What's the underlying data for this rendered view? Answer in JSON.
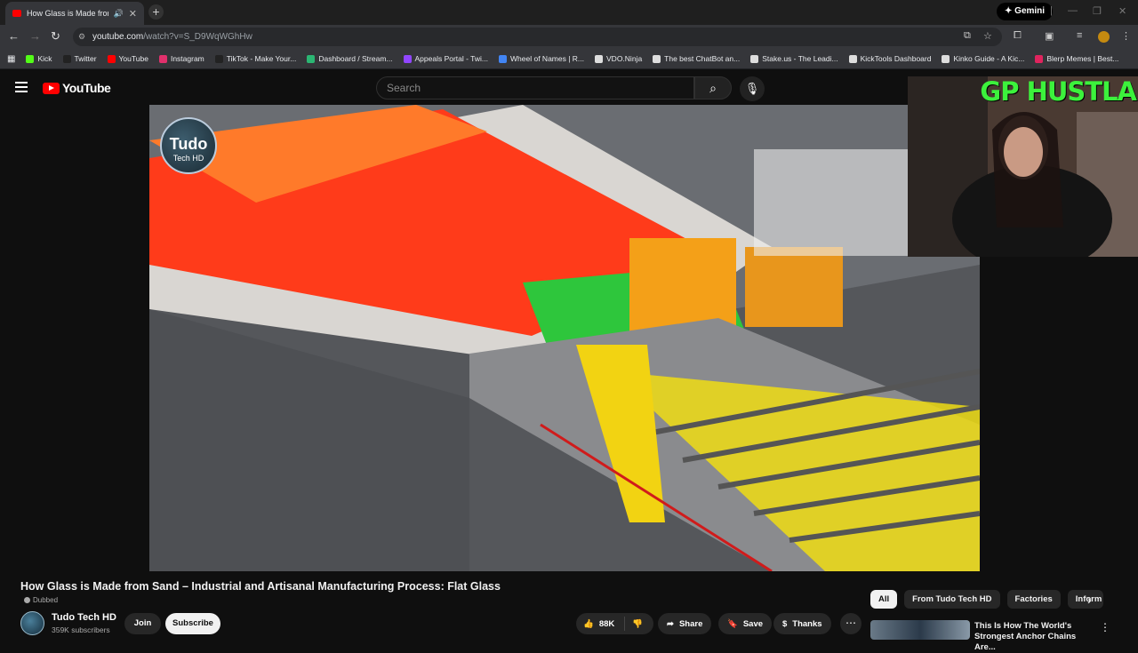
{
  "browser": {
    "tab_title": "How Glass is Made from Sa",
    "new_tab": "+",
    "tab_close": "✕",
    "gemini_label": "Gemini",
    "url_host": "youtube.com",
    "url_path": "/watch?v=S_D9WqWGhHw",
    "bookmarks": [
      {
        "label": "Kick",
        "color": "#53fc18"
      },
      {
        "label": "Twitter",
        "color": "#222222"
      },
      {
        "label": "YouTube",
        "color": "#ff0000"
      },
      {
        "label": "Instagram",
        "color": "#e1306c"
      },
      {
        "label": "TikTok - Make Your...",
        "color": "#222222"
      },
      {
        "label": "Dashboard / Stream...",
        "color": "#2bb673"
      },
      {
        "label": "Appeals Portal - Twi...",
        "color": "#9146ff"
      },
      {
        "label": "Wheel of Names | R...",
        "color": "#4285f4"
      },
      {
        "label": "VDO.Ninja",
        "color": "#dddddd"
      },
      {
        "label": "The best ChatBot an...",
        "color": "#dddddd"
      },
      {
        "label": "Stake.us - The Leadi...",
        "color": "#dddddd"
      },
      {
        "label": "KickTools Dashboard",
        "color": "#dddddd"
      },
      {
        "label": "Kinko Guide - A Kic...",
        "color": "#dddddd"
      },
      {
        "label": "Blerp Memes | Best...",
        "color": "#e0245e"
      }
    ]
  },
  "youtube": {
    "logo_text": "YouTube",
    "search_placeholder": "Search",
    "video_overlay_logo": {
      "line1": "Tudo",
      "line2": "Tech HD"
    },
    "webcam_title": "GP HUSTLA",
    "video_title": "How Glass is Made from Sand – Industrial and Artisanal Manufacturing Process: Flat Glass",
    "dubbed_label": "Dubbed",
    "channel_name": "Tudo Tech HD",
    "subscribers": "359K subscribers",
    "join_label": "Join",
    "subscribe_label": "Subscribe",
    "like_count": "88K",
    "share_label": "Share",
    "save_label": "Save",
    "thanks_label": "Thanks",
    "chips": [
      "All",
      "From Tudo Tech HD",
      "Factories",
      "Inform"
    ],
    "recommended_title": "This Is How The World's Strongest Anchor Chains Are..."
  }
}
